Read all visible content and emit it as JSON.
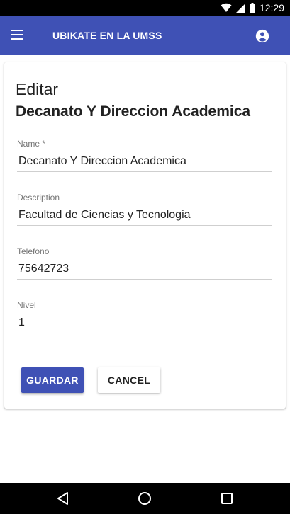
{
  "status_bar": {
    "time": "12:29"
  },
  "app_bar": {
    "title": "UBIKATE EN LA UMSS"
  },
  "form": {
    "heading": "Editar",
    "subheading": "Decanato Y Direccion Academica",
    "fields": [
      {
        "label": "Name *",
        "value": "Decanato Y Direccion Academica"
      },
      {
        "label": "Description",
        "value": "Facultad de Ciencias y Tecnologia"
      },
      {
        "label": "Telefono",
        "value": "75642723"
      },
      {
        "label": "Nivel",
        "value": "1"
      }
    ],
    "buttons": {
      "save_label": "GUARDAR",
      "cancel_label": "CANCEL"
    }
  },
  "colors": {
    "primary": "#3f51b5",
    "status_bar": "#000000",
    "nav_bar": "#000000"
  },
  "icons": [
    "wifi-icon",
    "cell-signal-icon",
    "battery-icon",
    "menu-icon",
    "account-circle-icon",
    "back-icon",
    "home-icon",
    "recents-icon"
  ]
}
